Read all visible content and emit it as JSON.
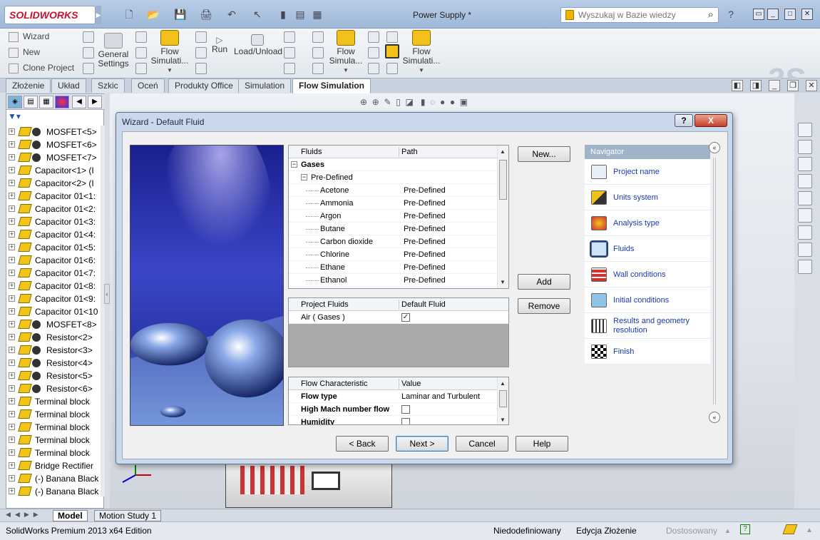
{
  "app": {
    "logo_text": "SOLIDWORKS",
    "document_title": "Power Supply *",
    "search_placeholder": "Wyszukaj w Bazie wiedzy"
  },
  "ribbon": {
    "small_buttons": [
      "Wizard",
      "New",
      "Clone Project"
    ],
    "general_settings": "General\nSettings",
    "flow_sim_1": "Flow\nSimulati...",
    "run": "Run",
    "load_unload": "Load/Unload",
    "flow_sim_2": "Flow\nSimula...",
    "flow_sim_3": "Flow\nSimulati..."
  },
  "tabs": [
    "Złożenie",
    "Układ",
    "Szkic",
    "Oceń",
    "Produkty Office",
    "Simulation",
    "Flow Simulation"
  ],
  "active_tab": "Flow Simulation",
  "tree": [
    {
      "label": "MOSFET<5>",
      "gear": true
    },
    {
      "label": "MOSFET<6>",
      "gear": true
    },
    {
      "label": "MOSFET<7>",
      "gear": true
    },
    {
      "label": "Capacitor<1> (I",
      "gear": false
    },
    {
      "label": "Capacitor<2> (I",
      "gear": false
    },
    {
      "label": "Capacitor 01<1:",
      "gear": false
    },
    {
      "label": "Capacitor 01<2:",
      "gear": false
    },
    {
      "label": "Capacitor 01<3:",
      "gear": false
    },
    {
      "label": "Capacitor 01<4:",
      "gear": false
    },
    {
      "label": "Capacitor 01<5:",
      "gear": false
    },
    {
      "label": "Capacitor 01<6:",
      "gear": false
    },
    {
      "label": "Capacitor 01<7:",
      "gear": false
    },
    {
      "label": "Capacitor 01<8:",
      "gear": false
    },
    {
      "label": "Capacitor 01<9:",
      "gear": false
    },
    {
      "label": "Capacitor 01<10",
      "gear": false
    },
    {
      "label": "MOSFET<8>",
      "gear": true
    },
    {
      "label": "Resistor<2>",
      "gear": true
    },
    {
      "label": "Resistor<3>",
      "gear": true
    },
    {
      "label": "Resistor<4>",
      "gear": true
    },
    {
      "label": "Resistor<5>",
      "gear": true
    },
    {
      "label": "Resistor<6>",
      "gear": true
    },
    {
      "label": "Terminal block",
      "gear": false
    },
    {
      "label": "Terminal block",
      "gear": false
    },
    {
      "label": "Terminal block",
      "gear": false
    },
    {
      "label": "Terminal block",
      "gear": false
    },
    {
      "label": "Terminal block",
      "gear": false
    },
    {
      "label": "Bridge Rectifier",
      "gear": false
    },
    {
      "label": "(-) Banana Black",
      "gear": false
    },
    {
      "label": "(-) Banana Black",
      "gear": false
    }
  ],
  "dialog": {
    "title": "Wizard - Default Fluid",
    "help_btn": "?",
    "close_btn": "X",
    "fluids_header": {
      "c1": "Fluids",
      "c2": "Path"
    },
    "gases_label": "Gases",
    "predefined_label": "Pre-Defined",
    "fluids": [
      {
        "name": "Acetone",
        "path": "Pre-Defined"
      },
      {
        "name": "Ammonia",
        "path": "Pre-Defined"
      },
      {
        "name": "Argon",
        "path": "Pre-Defined"
      },
      {
        "name": "Butane",
        "path": "Pre-Defined"
      },
      {
        "name": "Carbon dioxide",
        "path": "Pre-Defined"
      },
      {
        "name": "Chlorine",
        "path": "Pre-Defined"
      },
      {
        "name": "Ethane",
        "path": "Pre-Defined"
      },
      {
        "name": "Ethanol",
        "path": "Pre-Defined"
      }
    ],
    "project_header": {
      "c1": "Project Fluids",
      "c2": "Default Fluid"
    },
    "project_fluids": [
      {
        "name": "Air ( Gases )",
        "default": true
      }
    ],
    "flow_header": {
      "c1": "Flow Characteristic",
      "c2": "Value"
    },
    "flow_rows": [
      {
        "name": "Flow type",
        "value": "Laminar and Turbulent"
      },
      {
        "name": "High Mach number flow",
        "value": ""
      },
      {
        "name": "Humidity",
        "value": ""
      }
    ],
    "buttons": {
      "new": "New...",
      "add": "Add",
      "remove": "Remove",
      "back": "< Back",
      "next": "Next >",
      "cancel": "Cancel",
      "help": "Help"
    },
    "navigator": {
      "header": "Navigator",
      "items": [
        "Project name",
        "Units system",
        "Analysis type",
        "Fluids",
        "Wall conditions",
        "Initial conditions",
        "Results and geometry resolution",
        "Finish"
      ],
      "selected": "Fluids"
    }
  },
  "bottom_tabs": [
    "Model",
    "Motion Study 1"
  ],
  "status": {
    "edition": "SolidWorks Premium 2013 x64 Edition",
    "state": "Niedodefiniowany",
    "mode": "Edycja Złożenie",
    "custom": "Dostosowany"
  },
  "colors": {
    "accent": "#1f3f9c",
    "navigator_header": "#9fb3c9",
    "tree_icon": "#f0c419"
  }
}
